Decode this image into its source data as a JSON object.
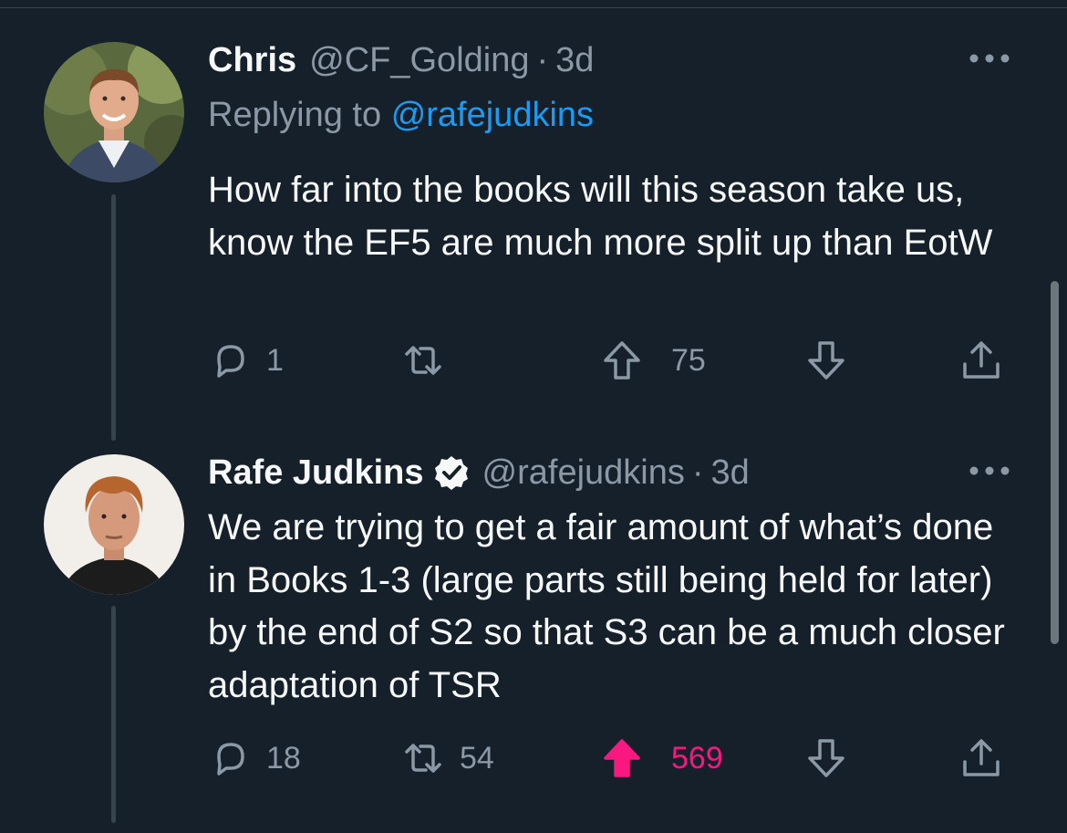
{
  "tweets": [
    {
      "display_name": "Chris",
      "handle": "@CF_Golding",
      "separator": "·",
      "time": "3d",
      "replying_label": "Replying to",
      "replying_handle": "@rafejudkins",
      "text": "How far into the books will this season take us, know the EF5 are much more split up than EotW",
      "counts": {
        "replies": "1",
        "reposts": "",
        "upvotes": "75"
      },
      "upvote_active": false,
      "verified": false
    },
    {
      "display_name": "Rafe Judkins",
      "handle": "@rafejudkins",
      "separator": "·",
      "time": "3d",
      "text": "We are trying to get a fair amount of what’s done in Books 1-3 (large parts still being held for later) by the end of S2 so that S3 can be a much closer adaptation of TSR",
      "counts": {
        "replies": "18",
        "reposts": "54",
        "upvotes": "569"
      },
      "upvote_active": true,
      "verified": true
    }
  ],
  "icons": {
    "reply": "reply-icon",
    "repost": "repost-icon",
    "upvote": "upvote-arrow-icon",
    "downvote": "downvote-arrow-icon",
    "share": "share-icon",
    "more": "more-options-icon",
    "verified": "verified-badge-icon"
  },
  "colors": {
    "background": "#15202b",
    "text": "#f7f9f9",
    "muted": "#8b98a5",
    "link": "#1d9bf0",
    "upvote_active": "#f91880"
  }
}
